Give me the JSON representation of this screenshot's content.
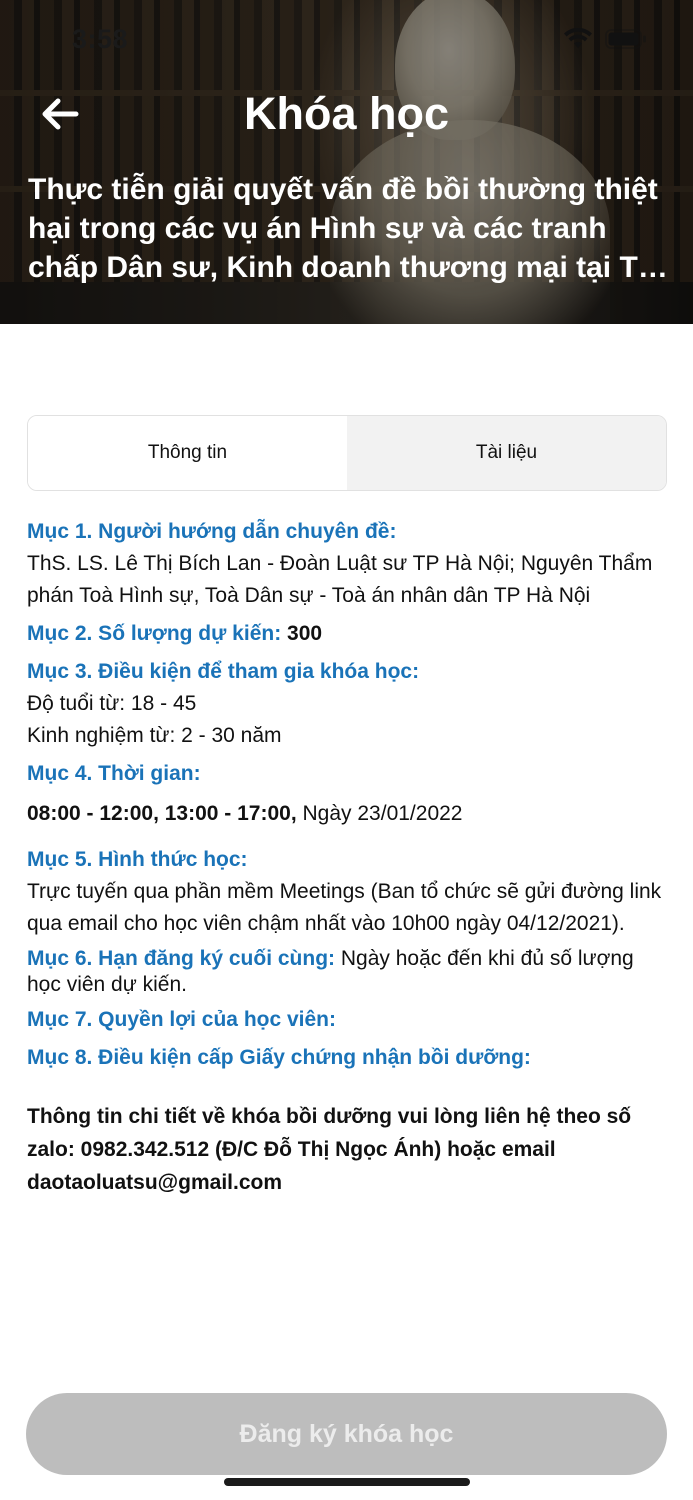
{
  "status_bar": {
    "time": "3:58"
  },
  "header": {
    "title": "Khóa học",
    "course_name": "Thực tiễn giải quyết vấn đề bồi thường thiệt hại trong các vụ án Hình sự và các tranh chấp Dân sư, Kinh doanh thương mại tại Tòa án"
  },
  "tabs": [
    {
      "label": "Thông tin",
      "active": true
    },
    {
      "label": "Tài liệu",
      "active": false
    }
  ],
  "sections": {
    "s1": {
      "heading": "Mục 1. Người hướng dẫn chuyên đề:",
      "body": "ThS. LS. Lê Thị Bích Lan - Đoàn Luật sư TP Hà Nội; Nguyên Thẩm phán Toà Hình sự, Toà Dân sự - Toà án nhân dân TP Hà Nội"
    },
    "s2": {
      "heading": "Mục 2. Số lượng dự kiến:",
      "value": "300"
    },
    "s3": {
      "heading": "Mục 3. Điều kiện để tham gia khóa học:",
      "age": "Độ tuổi từ: 18 - 45",
      "experience": "Kinh nghiệm từ: 2 - 30 năm"
    },
    "s4": {
      "heading": "Mục 4. Thời gian:",
      "hours": "08:00 - 12:00, 13:00 - 17:00,",
      "date": "Ngày 23/01/2022"
    },
    "s5": {
      "heading": "Mục 5. Hình thức học:",
      "body": "Trực tuyến qua phần mềm Meetings (Ban tổ chức sẽ gửi đường link qua email cho học viên chậm nhất vào 10h00 ngày 04/12/2021)."
    },
    "s6": {
      "heading": "Mục 6. Hạn đăng ký cuối cùng:",
      "body": "Ngày  hoặc đến khi đủ số lượng học viên dự kiến."
    },
    "s7": {
      "heading": "Mục 7. Quyền lợi của học viên:"
    },
    "s8": {
      "heading": "Mục 8. Điều kiện cấp Giấy chứng nhận bồi dưỡng:"
    }
  },
  "contact": "Thông tin chi tiết về khóa bồi dưỡng vui lòng liên hệ theo số zalo: 0982.342.512 (Đ/C Đỗ Thị Ngọc Ánh) hoặc email daotaoluatsu@gmail.com",
  "register_button": "Đăng ký khóa học",
  "colors": {
    "heading_blue": "#1a73b8",
    "button_disabled": "#bdbdbd",
    "button_text": "#ececec"
  },
  "icons": [
    "back-arrow-icon",
    "wifi-icon",
    "battery-icon"
  ]
}
